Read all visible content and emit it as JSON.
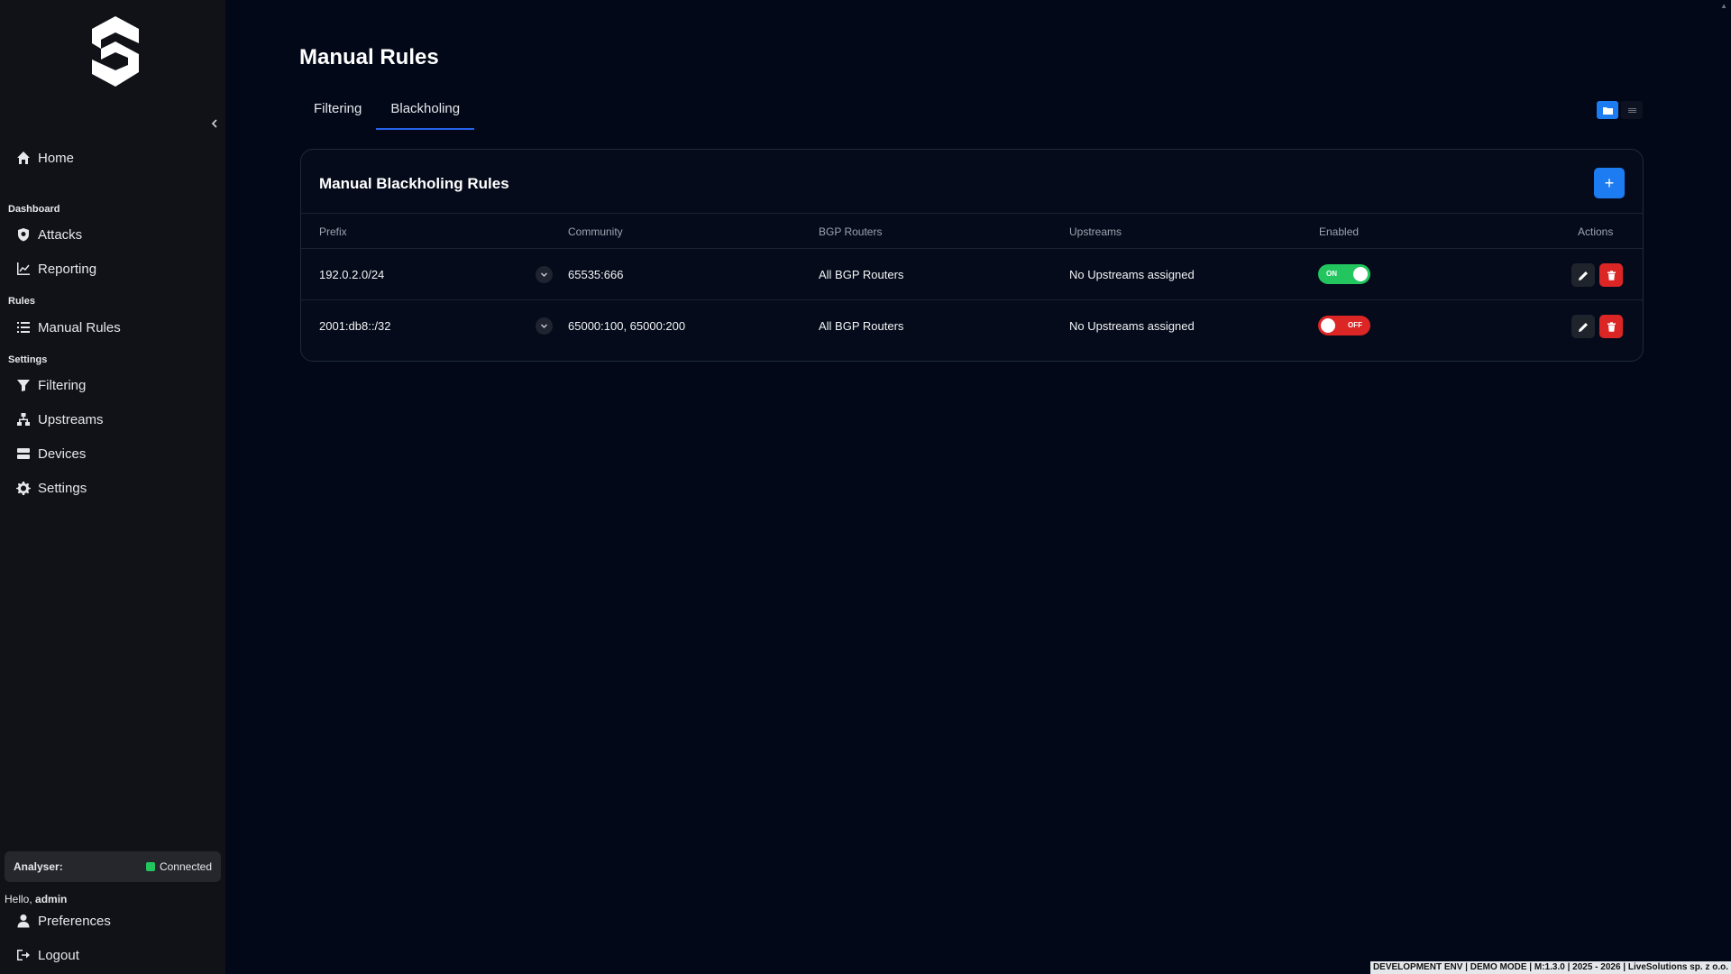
{
  "sidebar": {
    "nav": {
      "home": "Home",
      "section_dashboard": "Dashboard",
      "attacks": "Attacks",
      "reporting": "Reporting",
      "section_rules": "Rules",
      "manual_rules": "Manual Rules",
      "section_settings": "Settings",
      "filtering": "Filtering",
      "upstreams": "Upstreams",
      "devices": "Devices",
      "settings": "Settings"
    },
    "analyser": {
      "label": "Analyser:",
      "status": "Connected",
      "status_color": "#22c55e"
    },
    "greeting": {
      "prefix": "Hello,",
      "user": "admin"
    },
    "preferences": "Preferences",
    "logout": "Logout"
  },
  "main": {
    "title": "Manual Rules",
    "tabs": [
      {
        "label": "Filtering",
        "active": false
      },
      {
        "label": "Blackholing",
        "active": true
      }
    ],
    "card": {
      "title": "Manual Blackholing Rules",
      "add_label": "+",
      "columns": [
        "Prefix",
        "Community",
        "BGP Routers",
        "Upstreams",
        "Enabled",
        "Actions"
      ],
      "rows": [
        {
          "prefix": "192.0.2.0/24",
          "community": "65535:666",
          "routers": "All BGP Routers",
          "upstreams": "No Upstreams assigned",
          "enabled": true,
          "toggle_label": "ON"
        },
        {
          "prefix": "2001:db8::/32",
          "community": "65000:100, 65000:200",
          "routers": "All BGP Routers",
          "upstreams": "No Upstreams assigned",
          "enabled": false,
          "toggle_label": "OFF"
        }
      ]
    }
  },
  "footer": "DEVELOPMENT ENV | DEMO MODE | M:1.3.0 | 2025 - 2026 | LiveSolutions sp. z o.o.",
  "colors": {
    "accent": "#1d7cf2",
    "success": "#22c55e",
    "danger": "#dc2626",
    "background": "#020817"
  }
}
